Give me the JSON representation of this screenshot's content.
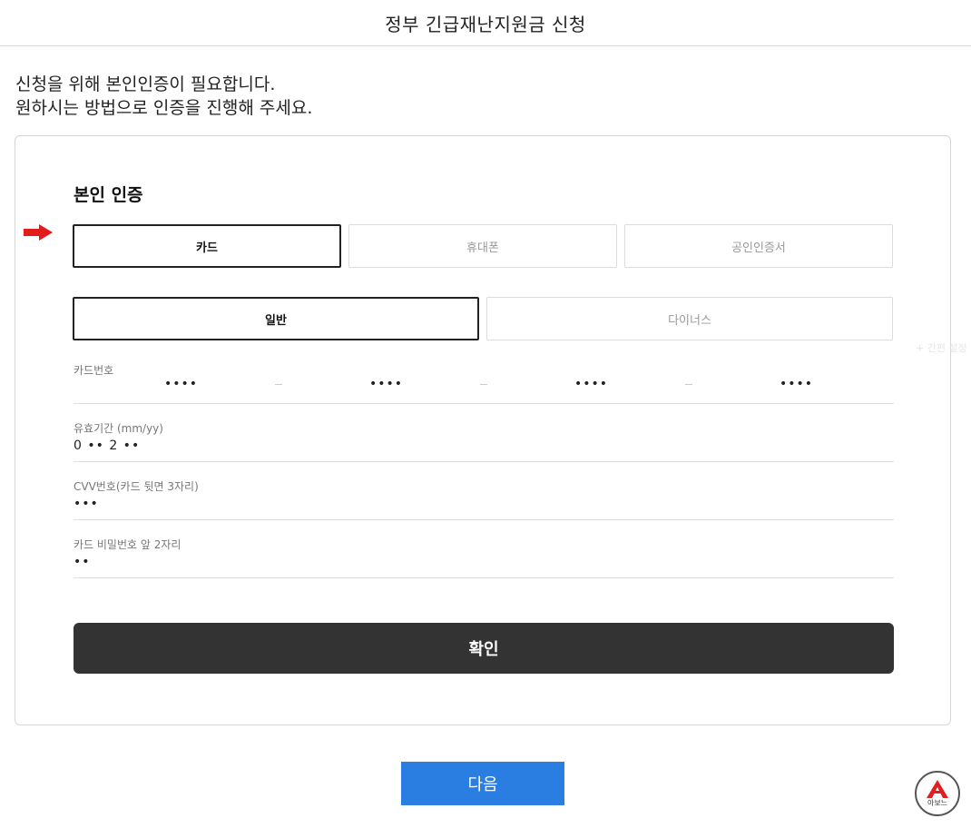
{
  "header": {
    "title": "정부 긴급재난지원금 신청"
  },
  "intro": {
    "line1": "신청을 위해 본인인증이 필요합니다.",
    "line2": "원하시는 방법으로 인증을 진행해 주세요."
  },
  "auth": {
    "title": "본인 인증",
    "methods": [
      {
        "label": "카드",
        "selected": true
      },
      {
        "label": "휴대폰",
        "selected": false
      },
      {
        "label": "공인인증서",
        "selected": false
      }
    ],
    "card_types": [
      {
        "label": "일반",
        "selected": true
      },
      {
        "label": "다이너스",
        "selected": false
      }
    ]
  },
  "fields": {
    "card_number": {
      "label": "카드번호",
      "segments": [
        "••••",
        "••••",
        "••••",
        "••••"
      ],
      "separator": "–"
    },
    "expiry": {
      "label": "유효기간 (mm/yy)",
      "value": "0 •• 2 ••"
    },
    "cvv": {
      "label": "CVV번호(카드 뒷면 3자리)",
      "value": "•••"
    },
    "pin": {
      "label": "카드 비밀번호 앞 2자리",
      "value": "••"
    }
  },
  "buttons": {
    "confirm": "확인",
    "next": "다음"
  },
  "overlay": {
    "faint_text": "+ 간편 설정"
  },
  "logo": {
    "text": "아보느"
  },
  "colors": {
    "next_button": "#2a7de1",
    "confirm_button": "#333333",
    "arrow": "#e21b1b",
    "logo_red": "#e02020"
  }
}
